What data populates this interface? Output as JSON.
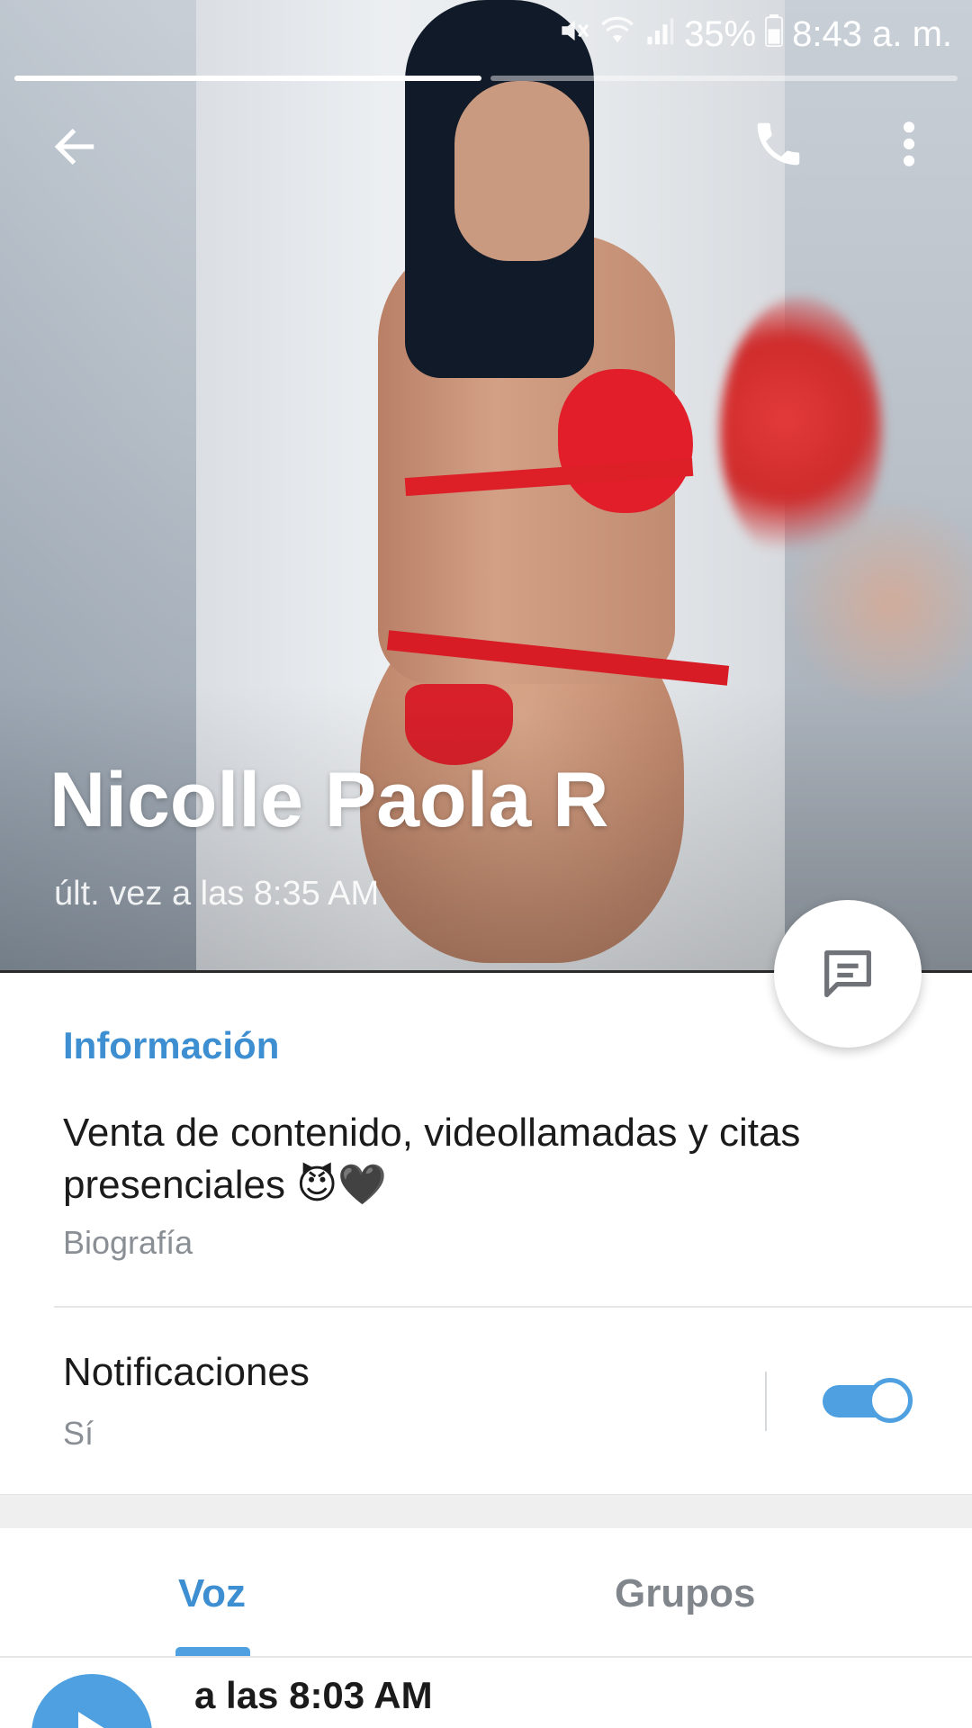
{
  "status_bar": {
    "battery": "35%",
    "time": "8:43 a. m."
  },
  "header": {
    "profile_name": "Nicolle Paola R",
    "last_seen": "últ. vez a las 8:35 AM"
  },
  "info": {
    "section_title": "Información",
    "bio_text": "Venta de contenido, videollamadas y citas presenciales ",
    "bio_emojis": "😈🖤",
    "bio_label": "Biografía"
  },
  "notifications": {
    "title": "Notificaciones",
    "value": "Sí",
    "enabled": true
  },
  "tabs": {
    "items": [
      {
        "label": "Voz",
        "active": true
      },
      {
        "label": "Grupos",
        "active": false
      }
    ]
  },
  "voice_list": {
    "items": [
      {
        "time_label": "a las 8:03 AM"
      }
    ]
  },
  "colors": {
    "accent": "#3d8fd1",
    "toggle": "#4ea0e0"
  },
  "icons": {
    "back": "arrow-left-icon",
    "call": "phone-icon",
    "more": "more-vertical-icon",
    "message": "message-icon",
    "play": "play-icon"
  }
}
